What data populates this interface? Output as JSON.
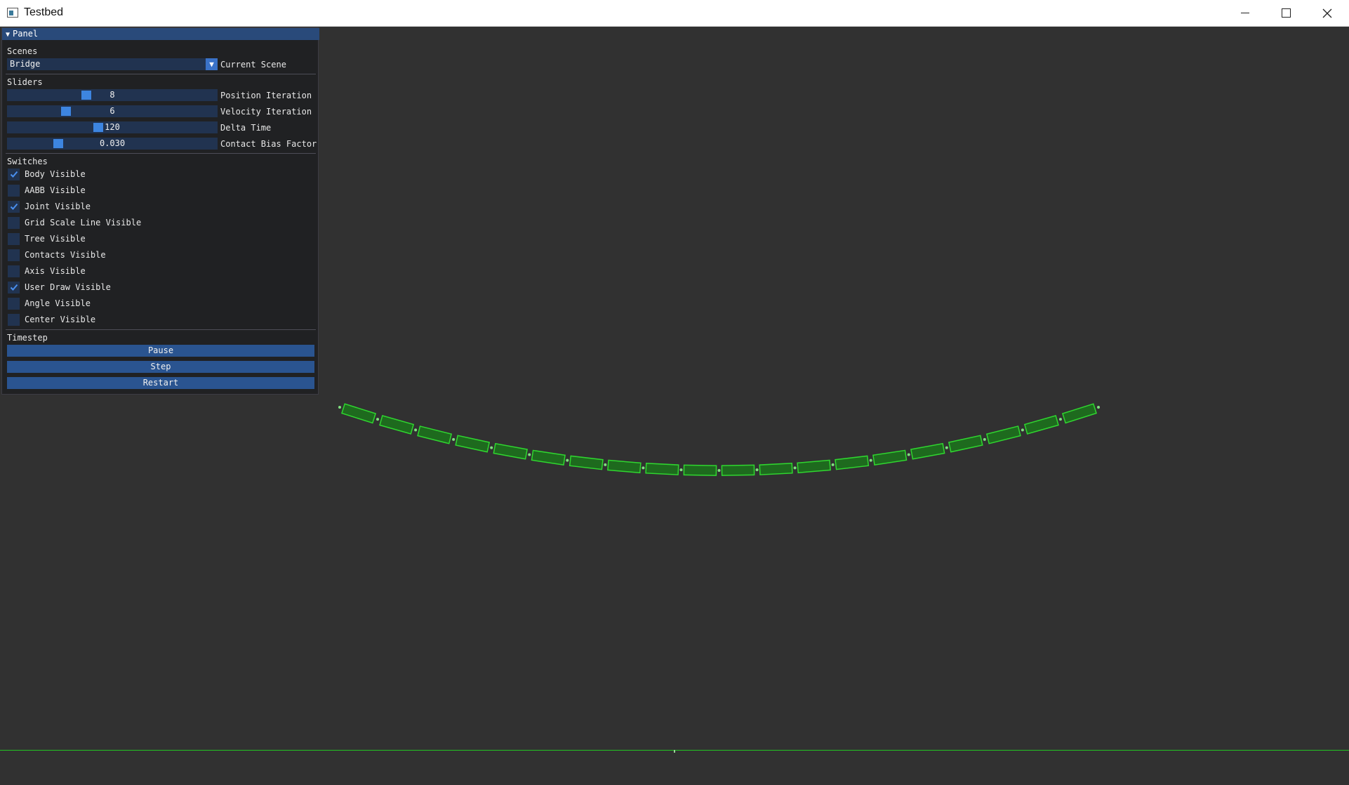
{
  "window": {
    "title": "Testbed"
  },
  "panel": {
    "title": "Panel",
    "scenes": {
      "label": "Scenes",
      "selected": "Bridge",
      "combo_label": "Current Scene"
    },
    "sliders": {
      "label": "Sliders",
      "items": [
        {
          "label": "Position Iteration",
          "value": "8",
          "fraction": 0.37
        },
        {
          "label": "Velocity Iteration",
          "value": "6",
          "fraction": 0.27
        },
        {
          "label": "Delta Time",
          "value": "120",
          "fraction": 0.43
        },
        {
          "label": "Contact Bias Factor",
          "value": "0.030",
          "fraction": 0.23
        }
      ]
    },
    "switches": {
      "label": "Switches",
      "items": [
        {
          "label": "Body Visible",
          "checked": true
        },
        {
          "label": "AABB Visible",
          "checked": false
        },
        {
          "label": "Joint Visible",
          "checked": true
        },
        {
          "label": "Grid Scale Line Visible",
          "checked": false
        },
        {
          "label": "Tree Visible",
          "checked": false
        },
        {
          "label": "Contacts Visible",
          "checked": false
        },
        {
          "label": "Axis Visible",
          "checked": false
        },
        {
          "label": "User Draw Visible",
          "checked": true
        },
        {
          "label": "Angle Visible",
          "checked": false
        },
        {
          "label": "Center Visible",
          "checked": false
        }
      ]
    },
    "timestep": {
      "label": "Timestep",
      "buttons": [
        "Pause",
        "Step",
        "Restart"
      ]
    }
  },
  "scene": {
    "plank_count": 20,
    "colors": {
      "outline": "#2fd62f",
      "fill": "#1e6a1e",
      "ground": "#22c322",
      "background": "#313131"
    }
  }
}
